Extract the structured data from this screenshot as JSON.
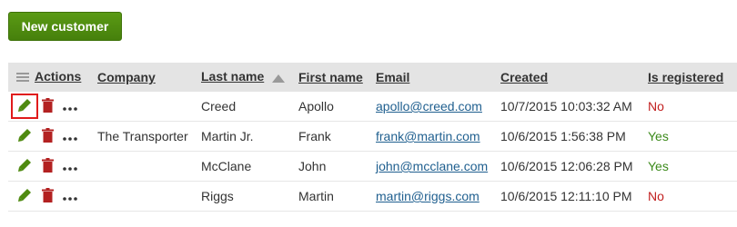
{
  "toolbar": {
    "new_customer_label": "New customer"
  },
  "table": {
    "headers": {
      "actions": "Actions",
      "company": "Company",
      "last_name": "Last name",
      "first_name": "First name",
      "email": "Email",
      "created": "Created",
      "is_registered": "Is registered"
    },
    "sort": {
      "column": "Last name",
      "direction": "ascending"
    },
    "rows": [
      {
        "company": "",
        "last_name": "Creed",
        "first_name": "Apollo",
        "email": "apollo@creed.com",
        "created": "10/7/2015 10:03:32 AM",
        "is_registered": "No"
      },
      {
        "company": "The Transporter",
        "last_name": "Martin Jr.",
        "first_name": "Frank",
        "email": "frank@martin.com",
        "created": "10/6/2015 1:56:38 PM",
        "is_registered": "Yes"
      },
      {
        "company": "",
        "last_name": "McClane",
        "first_name": "John",
        "email": "john@mcclane.com",
        "created": "10/6/2015 12:06:28 PM",
        "is_registered": "Yes"
      },
      {
        "company": "",
        "last_name": "Riggs",
        "first_name": "Martin",
        "email": "martin@riggs.com",
        "created": "10/6/2015 12:11:10 PM",
        "is_registered": "No"
      }
    ]
  },
  "colors": {
    "button_green": "#4f8a10",
    "edit_icon": "#4f8a10",
    "delete_icon": "#b32121",
    "link": "#1f5f8f",
    "yes": "#3c8a1b",
    "no": "#c22020",
    "focus_outline": "#e01b1b",
    "header_bg": "#e4e4e4"
  },
  "icons": {
    "menu": "hamburger-icon",
    "sort": "sort-ascending-icon",
    "edit": "pencil-icon",
    "delete": "trash-icon",
    "more": "ellipsis-icon"
  }
}
